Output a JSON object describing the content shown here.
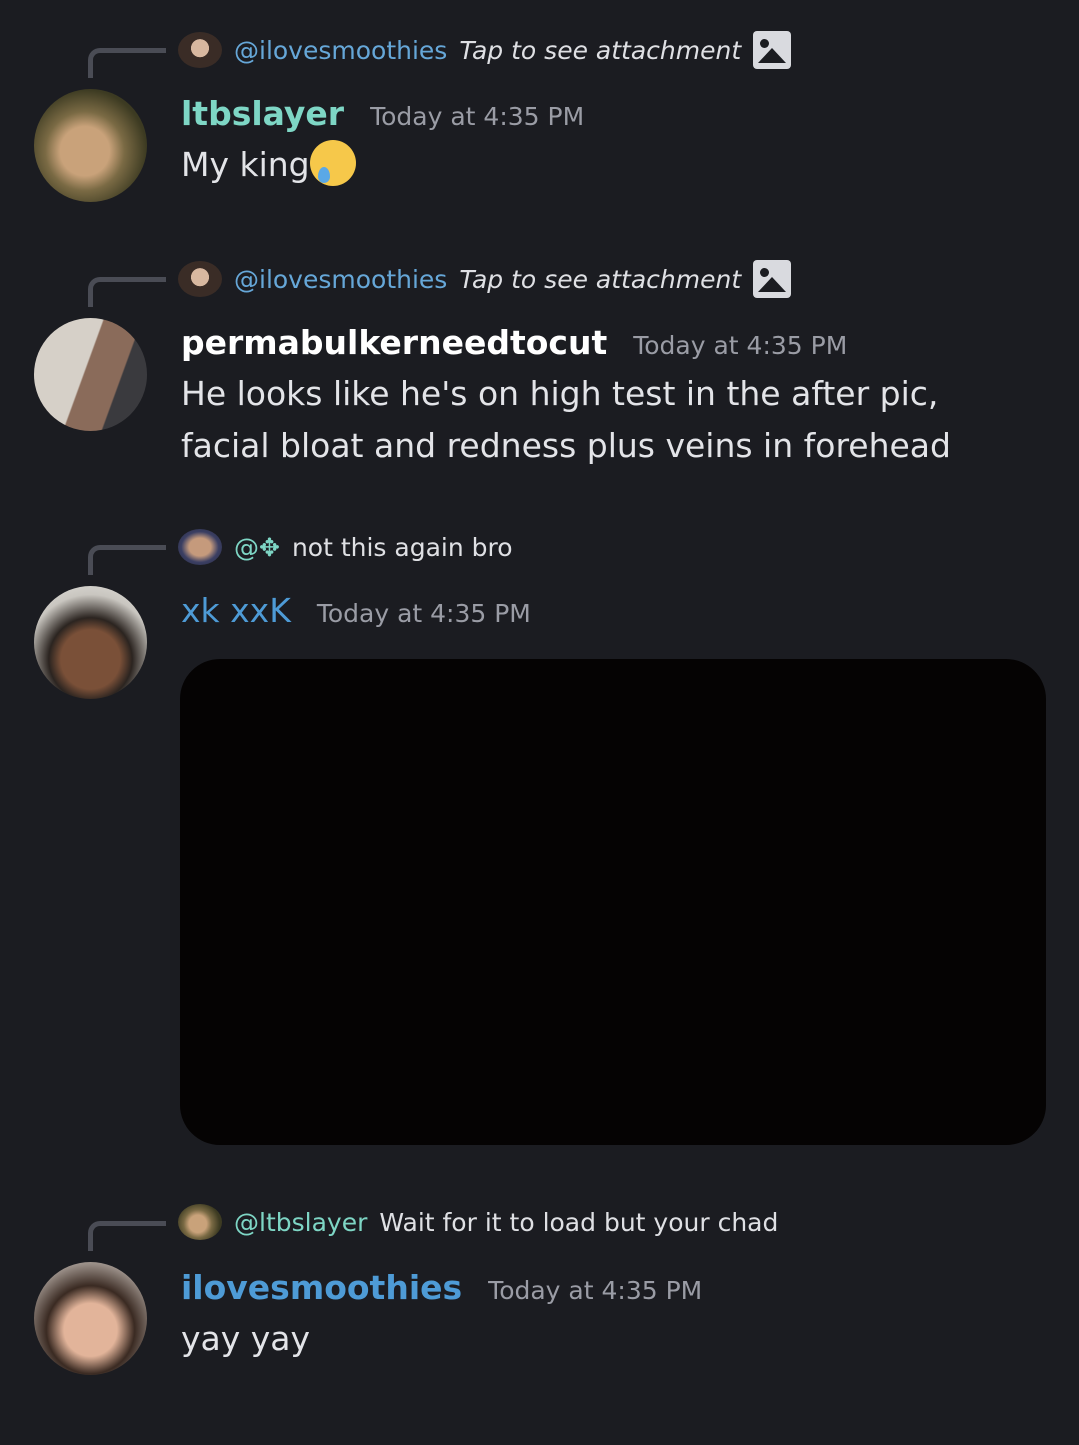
{
  "messages": [
    {
      "reply": {
        "mention": "@ilovesmoothies",
        "text": "Tap to see attachment",
        "has_attachment_icon": true
      },
      "username": "ltbslayer",
      "username_color": "#7ed6c5",
      "timestamp": "Today at 4:35 PM",
      "content": "My king",
      "emoji": "crying-face-icon"
    },
    {
      "reply": {
        "mention": "@ilovesmoothies",
        "text": "Tap to see attachment",
        "has_attachment_icon": true
      },
      "username": "permabulkerneedtocut",
      "username_color": "#ffffff",
      "timestamp": "Today at 4:35 PM",
      "content": "He looks like he's on high test in the after pic, facial bloat and redness  plus veins in forehead"
    },
    {
      "reply": {
        "mention": "@✥",
        "text": "not this again bro"
      },
      "username": "xk xxK",
      "username_color": "#4e9bd6",
      "timestamp": "Today at 4:35 PM",
      "content": ""
    },
    {
      "reply": {
        "mention": "@ltbslayer",
        "text": "Wait for it to load but your chad"
      },
      "username": "ilovesmoothies",
      "username_color": "#4e9bd6",
      "timestamp": "Today at 4:35 PM",
      "content": "yay yay"
    }
  ]
}
